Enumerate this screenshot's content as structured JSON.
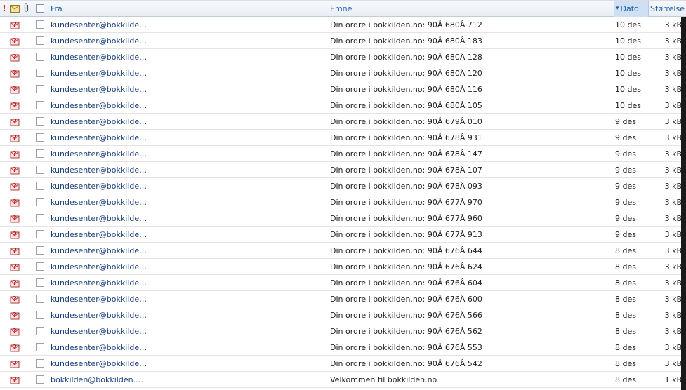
{
  "header": {
    "flag_glyph": "!",
    "from": "Fra",
    "subject": "Emne",
    "date": "Dato",
    "size": "Størrelse",
    "sort_arrow": "▾"
  },
  "icons": {
    "status": "unknown-mail-icon",
    "attachment": "paperclip-icon",
    "envelope": "envelope-icon"
  },
  "colors": {
    "link_blue": "#1a3f7a",
    "header_blue": "#1f5fa8",
    "sorted_column_bg": "#cfe0f3",
    "priority_red": "#d2342a"
  },
  "messages": [
    {
      "from": "kundesenter@bokkilde…",
      "subject": "Din ordre i bokkilden.no: 90Â 680Â 712",
      "date": "10 des",
      "size": "3 kB"
    },
    {
      "from": "kundesenter@bokkilde…",
      "subject": "Din ordre i bokkilden.no: 90Â 680Â 183",
      "date": "10 des",
      "size": "3 kB"
    },
    {
      "from": "kundesenter@bokkilde…",
      "subject": "Din ordre i bokkilden.no: 90Â 680Â 128",
      "date": "10 des",
      "size": "3 kB"
    },
    {
      "from": "kundesenter@bokkilde…",
      "subject": "Din ordre i bokkilden.no: 90Â 680Â 120",
      "date": "10 des",
      "size": "3 kB"
    },
    {
      "from": "kundesenter@bokkilde…",
      "subject": "Din ordre i bokkilden.no: 90Â 680Â 116",
      "date": "10 des",
      "size": "3 kB"
    },
    {
      "from": "kundesenter@bokkilde…",
      "subject": "Din ordre i bokkilden.no: 90Â 680Â 105",
      "date": "10 des",
      "size": "3 kB"
    },
    {
      "from": "kundesenter@bokkilde…",
      "subject": "Din ordre i bokkilden.no: 90Â 679Â 010",
      "date": "9 des",
      "size": "3 kB"
    },
    {
      "from": "kundesenter@bokkilde…",
      "subject": "Din ordre i bokkilden.no: 90Â 678Â 931",
      "date": "9 des",
      "size": "3 kB"
    },
    {
      "from": "kundesenter@bokkilde…",
      "subject": "Din ordre i bokkilden.no: 90Â 678Â 147",
      "date": "9 des",
      "size": "3 kB"
    },
    {
      "from": "kundesenter@bokkilde…",
      "subject": "Din ordre i bokkilden.no: 90Â 678Â 107",
      "date": "9 des",
      "size": "3 kB"
    },
    {
      "from": "kundesenter@bokkilde…",
      "subject": "Din ordre i bokkilden.no: 90Â 678Â 093",
      "date": "9 des",
      "size": "3 kB"
    },
    {
      "from": "kundesenter@bokkilde…",
      "subject": "Din ordre i bokkilden.no: 90Â 677Â 970",
      "date": "9 des",
      "size": "3 kB"
    },
    {
      "from": "kundesenter@bokkilde…",
      "subject": "Din ordre i bokkilden.no: 90Â 677Â 960",
      "date": "9 des",
      "size": "3 kB"
    },
    {
      "from": "kundesenter@bokkilde…",
      "subject": "Din ordre i bokkilden.no: 90Â 677Â 913",
      "date": "9 des",
      "size": "3 kB"
    },
    {
      "from": "kundesenter@bokkilde…",
      "subject": "Din ordre i bokkilden.no: 90Â 676Â 644",
      "date": "8 des",
      "size": "3 kB"
    },
    {
      "from": "kundesenter@bokkilde…",
      "subject": "Din ordre i bokkilden.no: 90Â 676Â 624",
      "date": "8 des",
      "size": "3 kB"
    },
    {
      "from": "kundesenter@bokkilde…",
      "subject": "Din ordre i bokkilden.no: 90Â 676Â 604",
      "date": "8 des",
      "size": "3 kB"
    },
    {
      "from": "kundesenter@bokkilde…",
      "subject": "Din ordre i bokkilden.no: 90Â 676Â 600",
      "date": "8 des",
      "size": "3 kB"
    },
    {
      "from": "kundesenter@bokkilde…",
      "subject": "Din ordre i bokkilden.no: 90Â 676Â 566",
      "date": "8 des",
      "size": "3 kB"
    },
    {
      "from": "kundesenter@bokkilde…",
      "subject": "Din ordre i bokkilden.no: 90Â 676Â 562",
      "date": "8 des",
      "size": "3 kB"
    },
    {
      "from": "kundesenter@bokkilde…",
      "subject": "Din ordre i bokkilden.no: 90Â 676Â 553",
      "date": "8 des",
      "size": "3 kB"
    },
    {
      "from": "kundesenter@bokkilde…",
      "subject": "Din ordre i bokkilden.no: 90Â 676Â 542",
      "date": "8 des",
      "size": "3 kB"
    },
    {
      "from": "bokkilden@bokkilden.…",
      "subject": "Velkommen til bokkilden.no",
      "date": "8 des",
      "size": "1 kB"
    }
  ]
}
